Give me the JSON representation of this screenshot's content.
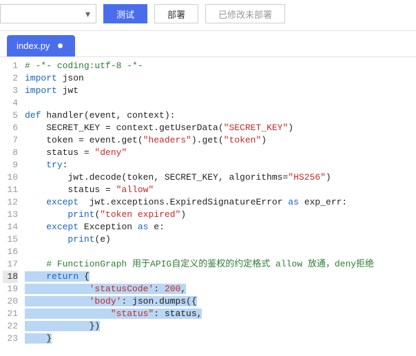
{
  "toolbar": {
    "dropdown_value": "",
    "test_label": "测试",
    "deploy_label": "部署",
    "status_label": "已修改未部署"
  },
  "tab": {
    "filename": "index.py",
    "modified": true
  },
  "code": {
    "lines": [
      "# -*- coding:utf-8 -*-",
      "import json",
      "import jwt",
      "",
      "def handler(event, context):",
      "    SECRET_KEY = context.getUserData(\"SECRET_KEY\")",
      "    token = event.get(\"headers\").get(\"token\")",
      "    status = \"deny\"",
      "    try:",
      "        jwt.decode(token, SECRET_KEY, algorithms=\"HS256\")",
      "        status = \"allow\"",
      "    except  jwt.exceptions.ExpiredSignatureError as exp_err:",
      "        print(\"token expired\")",
      "    except Exception as e:",
      "        print(e)",
      "",
      "    # FunctionGraph 用于APIG自定义的鉴权的约定格式 allow 放通，deny拒绝",
      "    return {",
      "            'statusCode': 200,",
      "            'body': json.dumps({",
      "                \"status\": status,",
      "            })",
      "    }"
    ],
    "highlighted_line": 18,
    "selection_start": 18,
    "selection_end": 23
  }
}
